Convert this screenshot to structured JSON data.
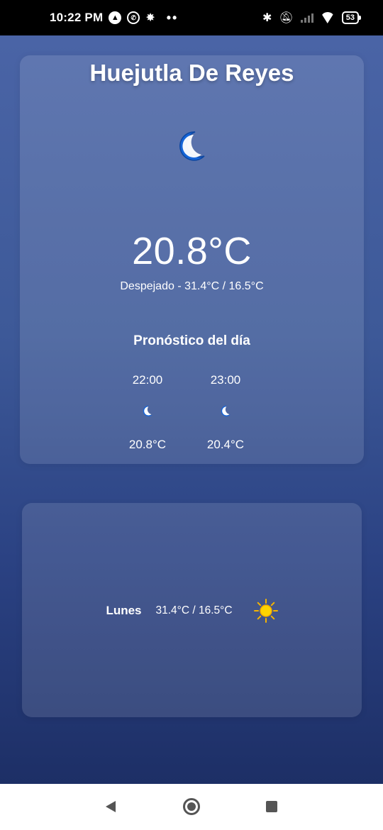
{
  "status_bar": {
    "time": "10:22 PM",
    "dots": "••",
    "battery": "53",
    "icons": [
      "autonavi-icon",
      "whatsapp-icon",
      "bug-icon",
      "bluetooth-icon",
      "mute-icon",
      "signal-icon",
      "wifi-icon",
      "battery-icon"
    ]
  },
  "current": {
    "city": "Huejutla De Reyes",
    "icon": "moon-icon",
    "temperature": "20.8°C",
    "description": "Despejado - 31.4°C / 16.5°C"
  },
  "forecast": {
    "title": "Pronóstico del día",
    "hours": [
      {
        "time": "22:00",
        "icon": "moon-icon",
        "temp": "20.8°C"
      },
      {
        "time": "23:00",
        "icon": "moon-icon",
        "temp": "20.4°C"
      }
    ]
  },
  "week": {
    "days": [
      {
        "name": "Lunes",
        "range": "31.4°C / 16.5°C",
        "icon": "sun-icon"
      }
    ]
  },
  "colors": {
    "background_top": "#4a64a6",
    "background_bottom": "#1d2f66",
    "moon": "#1565d8",
    "sun": "#f5c400"
  }
}
